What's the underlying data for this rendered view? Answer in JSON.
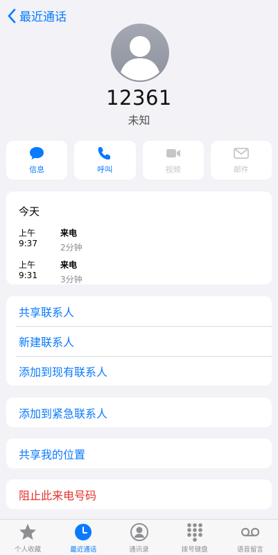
{
  "nav": {
    "back_label": "最近通话"
  },
  "caller": {
    "number": "12361",
    "label": "未知"
  },
  "actions": [
    {
      "label": "信息",
      "icon": "message-icon",
      "enabled": true
    },
    {
      "label": "呼叫",
      "icon": "phone-icon",
      "enabled": true
    },
    {
      "label": "视频",
      "icon": "video-icon",
      "enabled": false
    },
    {
      "label": "邮件",
      "icon": "mail-icon",
      "enabled": false
    }
  ],
  "history": {
    "day": "今天",
    "entries": [
      {
        "time": "上午 9:37",
        "type": "来电",
        "duration": "2分钟"
      },
      {
        "time": "上午 9:31",
        "type": "来电",
        "duration": "3分钟"
      }
    ]
  },
  "contact_actions": [
    "共享联系人",
    "新建联系人",
    "添加到现有联系人"
  ],
  "emergency": "添加到紧急联系人",
  "share_location": "共享我的位置",
  "block": "阻止此来电号码",
  "tabs": [
    {
      "label": "个人收藏",
      "icon": "star-icon",
      "active": false
    },
    {
      "label": "最近通话",
      "icon": "clock-icon",
      "active": true
    },
    {
      "label": "通讯录",
      "icon": "contacts-icon",
      "active": false
    },
    {
      "label": "拨号键盘",
      "icon": "keypad-icon",
      "active": false
    },
    {
      "label": "语音留言",
      "icon": "voicemail-icon",
      "active": false
    }
  ],
  "colors": {
    "accent": "#0a7aff",
    "danger": "#e5312c",
    "background": "#f2f2f7"
  }
}
